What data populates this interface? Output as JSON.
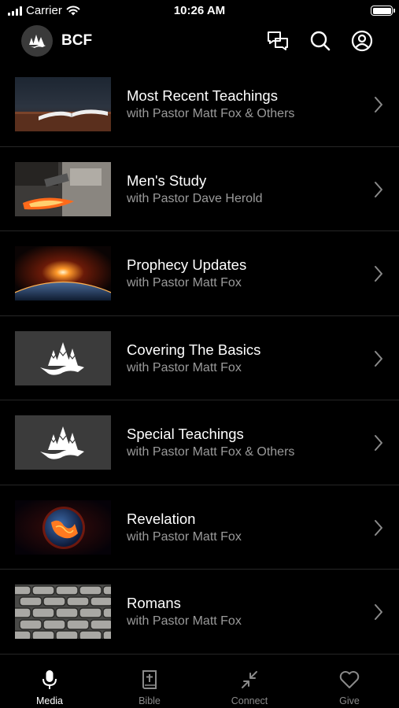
{
  "status_bar": {
    "carrier": "Carrier",
    "time": "10:26 AM"
  },
  "header": {
    "brand": "BCF"
  },
  "items": [
    {
      "title": "Most Recent Teachings",
      "subtitle": "with Pastor Matt Fox & Others"
    },
    {
      "title": "Men's Study",
      "subtitle": "with Pastor Dave Herold"
    },
    {
      "title": "Prophecy Updates",
      "subtitle": "with Pastor Matt Fox"
    },
    {
      "title": "Covering The Basics",
      "subtitle": "with Pastor Matt Fox"
    },
    {
      "title": "Special Teachings",
      "subtitle": "with Pastor Matt Fox & Others"
    },
    {
      "title": "Revelation",
      "subtitle": "with Pastor Matt Fox"
    },
    {
      "title": "Romans",
      "subtitle": "with Pastor Matt Fox"
    }
  ],
  "tabs": [
    {
      "label": "Media",
      "icon": "microphone-icon",
      "active": true
    },
    {
      "label": "Bible",
      "icon": "bible-icon",
      "active": false
    },
    {
      "label": "Connect",
      "icon": "connect-arrows-icon",
      "active": false
    },
    {
      "label": "Give",
      "icon": "heart-icon",
      "active": false
    }
  ],
  "colors": {
    "background": "#000000",
    "subtitle": "#9a9a9a",
    "inactive_tab": "#8a8a8a",
    "divider": "#262626"
  }
}
